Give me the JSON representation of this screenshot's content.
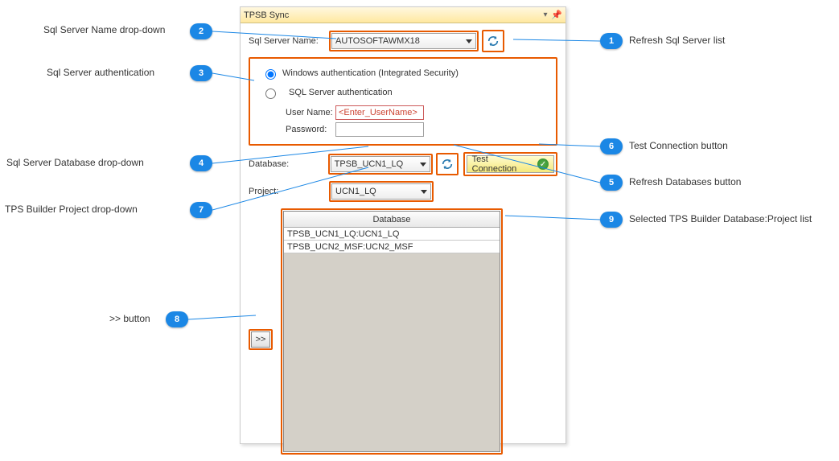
{
  "panel": {
    "title": "TPSB Sync"
  },
  "server": {
    "label": "Sql Server Name:",
    "value": "AUTOSOFTAWMX18"
  },
  "auth": {
    "windows_label": "Windows authentication (Integrated Security)",
    "sql_label": "SQL Server authentication",
    "user_label": "User Name:",
    "user_placeholder": "<Enter_UserName>",
    "pass_label": "Password:"
  },
  "database": {
    "label": "Database:",
    "value": "TPSB_UCN1_LQ"
  },
  "project": {
    "label": "Project:",
    "value": "UCN1_LQ"
  },
  "test_connection_label": "Test Connection",
  "list": {
    "header": "Database",
    "rows": [
      "TPSB_UCN1_LQ:UCN1_LQ",
      "TPSB_UCN2_MSF:UCN2_MSF"
    ]
  },
  "add_button_label": ">>",
  "annotations": {
    "1": "Refresh Sql Server list",
    "2": "Sql Server Name drop-down",
    "3": "Sql Server authentication",
    "4": "Sql Server Database drop-down",
    "5": "Refresh Databases button",
    "6": "Test Connection button",
    "7": "TPS Builder Project drop-down",
    "8": ">> button",
    "9": "Selected TPS Builder Database:Project list"
  }
}
